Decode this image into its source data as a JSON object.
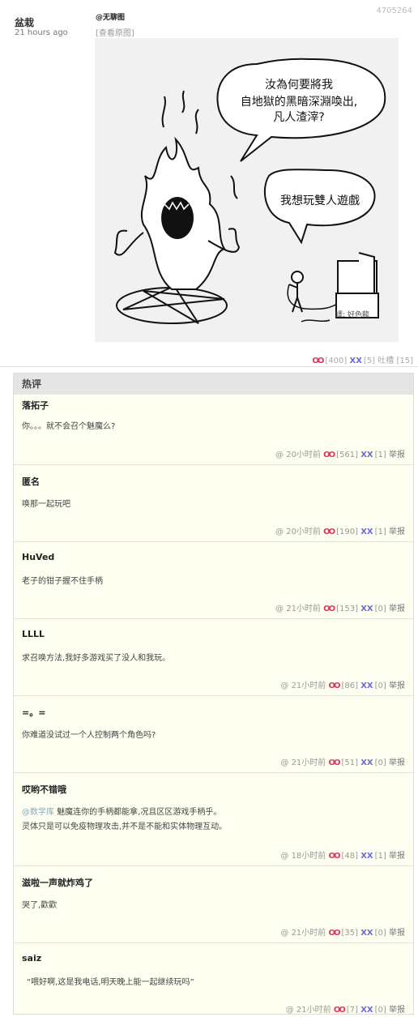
{
  "post": {
    "author": "盆栽",
    "time": "21 hours ago",
    "id": "4705264",
    "at_name": "@无聊图",
    "view_original": "[查看原图]",
    "comic": {
      "bubble1": [
        "汝為何要將我",
        "自地獄的黑暗深淵喚出,",
        "凡人渣滓?"
      ],
      "bubble2": "我想玩雙人遊戲",
      "watermark": "譯: 好色龍"
    },
    "votes": {
      "oo_count": "[400]",
      "xx_count": "[5]",
      "tucao_label": "吐槽",
      "tucao_count": "[15]"
    }
  },
  "hot": {
    "title": "热评",
    "comments": [
      {
        "name": "落拓子",
        "lines": [
          "你。。。就不会召个魅魔么?"
        ],
        "time": "20小时前",
        "oo": "[561]",
        "xx": "[1]"
      },
      {
        "name": "匿名",
        "lines": [
          "唤那一起玩吧"
        ],
        "time": "20小时前",
        "oo": "[190]",
        "xx": "[1]"
      },
      {
        "name": "HuVed",
        "lines": [
          "老子的钳子握不住手柄"
        ],
        "time": "21小时前",
        "oo": "[153]",
        "xx": "[0]"
      },
      {
        "name": "LLLL",
        "lines": [
          "求召唤方法,我好多游戏买了没人和我玩。"
        ],
        "time": "21小时前",
        "oo": "[86]",
        "xx": "[0]"
      },
      {
        "name": "=。=",
        "lines": [
          "你难道没试过一个人控制两个角色吗?"
        ],
        "time": "21小时前",
        "oo": "[51]",
        "xx": "[0]"
      },
      {
        "name": "哎哟不错哦",
        "mention": "@数学库",
        "lines": [
          "魅魔连你的手柄都能拿,况且区区游戏手柄乎。",
          "灵体只是可以免疫物理攻击,并不是不能和实体物理互动。"
        ],
        "time": "18小时前",
        "oo": "[48]",
        "xx": "[1]"
      },
      {
        "name": "滋啦一声就炸鸡了",
        "lines": [
          "哭了,歡歡"
        ],
        "time": "21小时前",
        "oo": "[35]",
        "xx": "[0]"
      },
      {
        "name": "saiz",
        "lines": [
          "“喂好啊,这是我电话,明天晚上能一起继续玩吗”"
        ],
        "time": "21小时前",
        "oo": "[7]",
        "xx": "[0]"
      }
    ],
    "at_symbol": "@",
    "oo_label": "OO",
    "xx_label": "XX",
    "report_label": "举报"
  },
  "colors": {
    "oo": "#e0365b",
    "xx": "#6a6add",
    "hot_bg": "#fffff2"
  }
}
